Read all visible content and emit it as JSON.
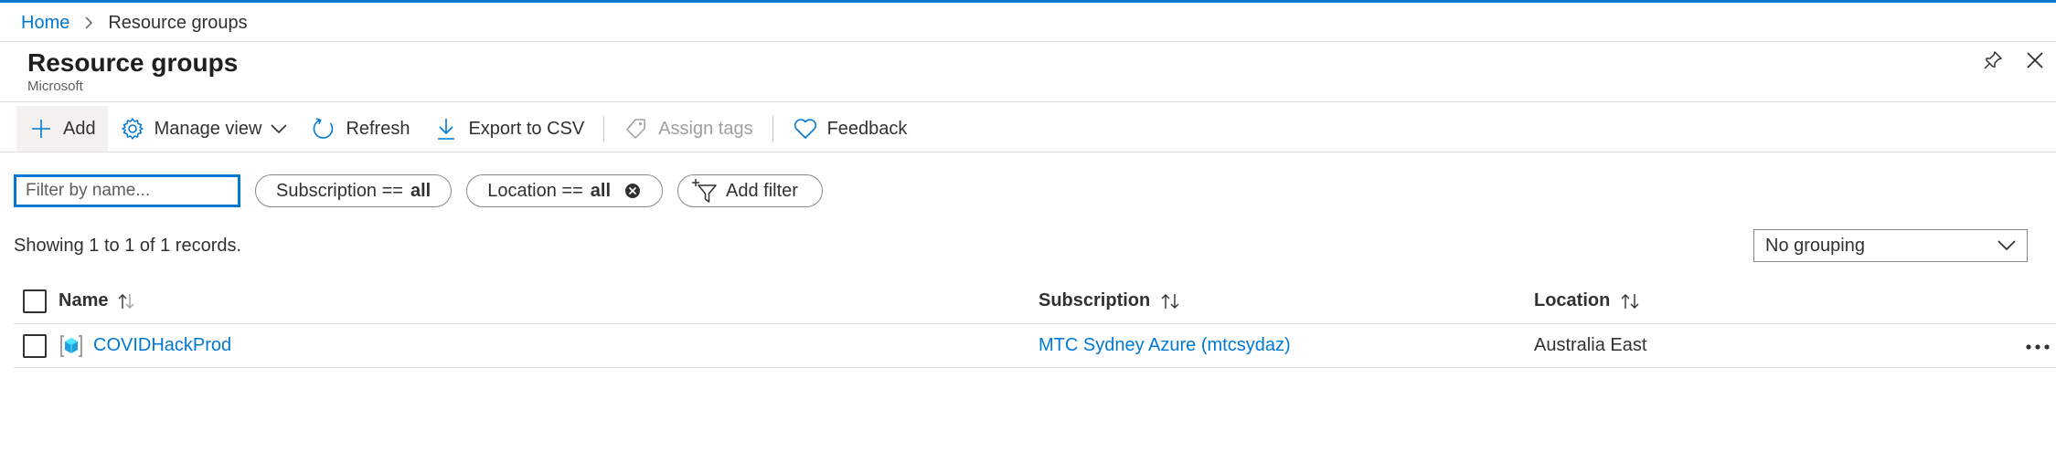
{
  "colors": {
    "accent": "#0078d4",
    "text": "#323130",
    "border": "#e1dfdd",
    "disabled": "#a19f9d",
    "resource_group_icon": "#1ba1e2"
  },
  "breadcrumb": {
    "items": [
      {
        "label": "Home",
        "link": true
      },
      {
        "label": "Resource groups",
        "link": false
      }
    ],
    "separator_icon": "chevron-right-icon"
  },
  "header": {
    "title": "Resource groups",
    "subtitle": "Microsoft",
    "actions": [
      {
        "name": "pin",
        "icon": "pin-icon"
      },
      {
        "name": "close",
        "icon": "close-icon"
      }
    ]
  },
  "toolbar": {
    "add_label": "Add",
    "manage_view_label": "Manage view",
    "refresh_label": "Refresh",
    "export_label": "Export to CSV",
    "assign_tags_label": "Assign tags",
    "feedback_label": "Feedback"
  },
  "filters": {
    "search": {
      "placeholder": "Filter by name...",
      "value": ""
    },
    "subscription": {
      "key": "Subscription ==",
      "value": "all"
    },
    "location": {
      "key": "Location ==",
      "value": "all"
    },
    "add_filter_label": "Add filter"
  },
  "records_text": "Showing 1 to 1 of 1 records.",
  "grouping": {
    "selected": "No grouping"
  },
  "table": {
    "columns": [
      "Name",
      "Subscription",
      "Location"
    ],
    "rows": [
      {
        "name": "COVIDHackProd",
        "subscription": "MTC Sydney Azure (mtcsydaz)",
        "location": "Australia East"
      }
    ]
  }
}
